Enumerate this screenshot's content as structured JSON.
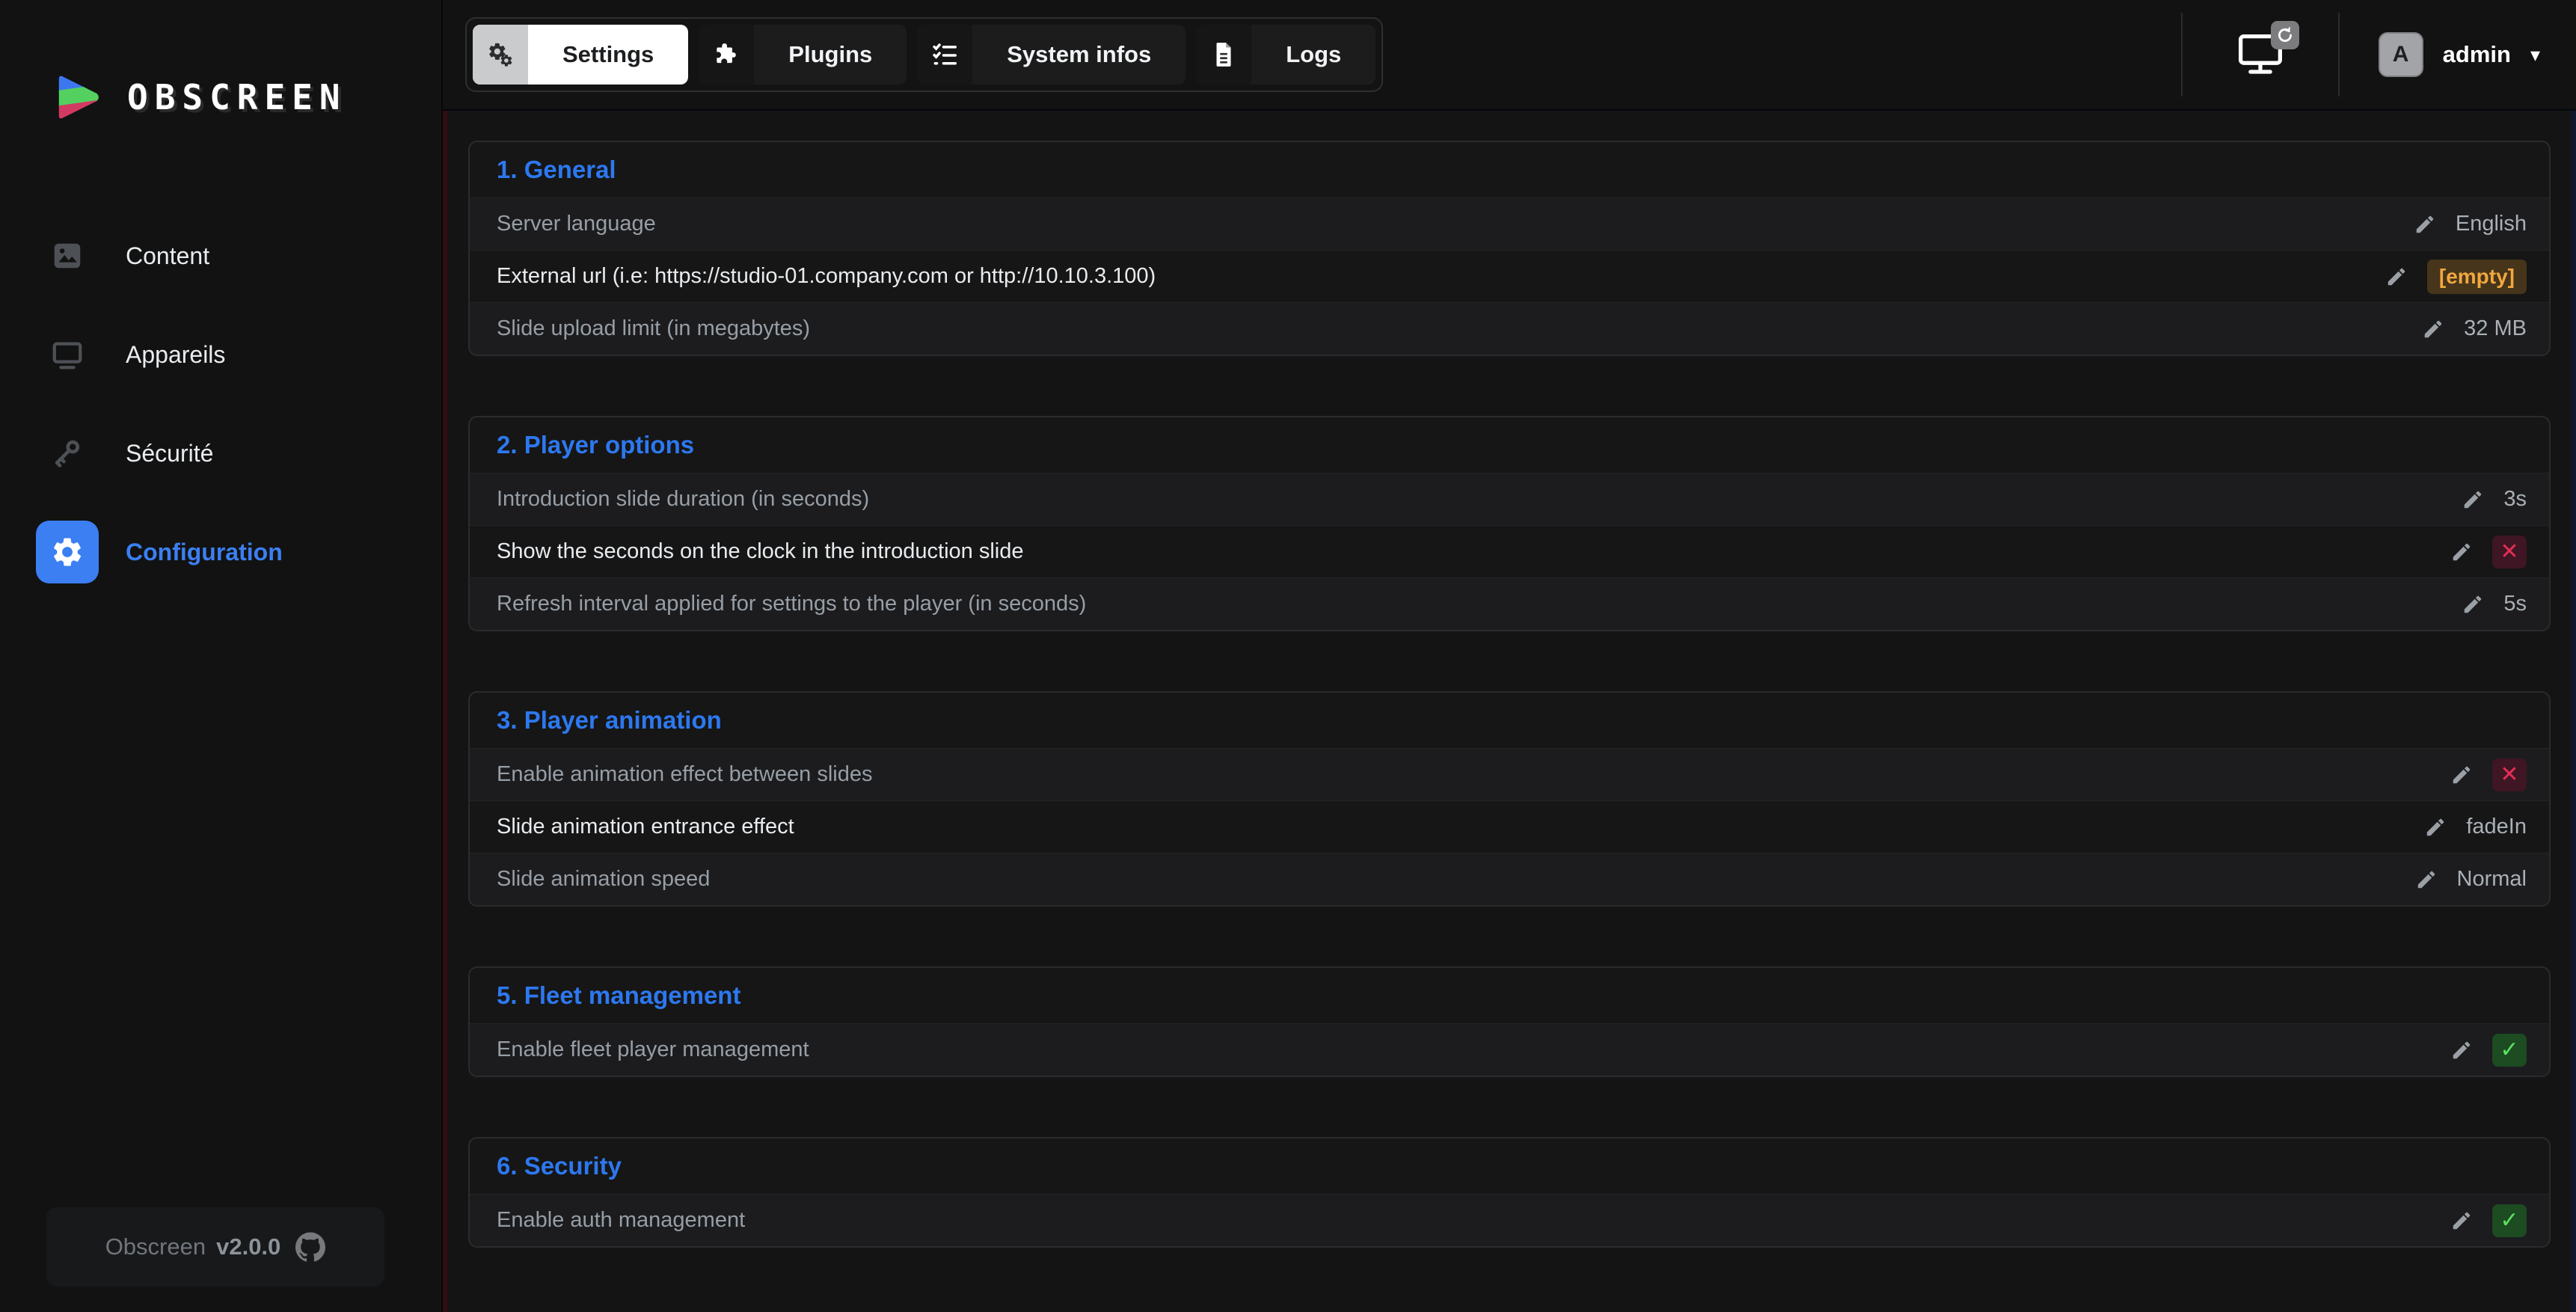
{
  "brand": {
    "name": "OBSCREEN"
  },
  "sidebar": {
    "items": [
      {
        "label": "Content"
      },
      {
        "label": "Appareils"
      },
      {
        "label": "Sécurité"
      },
      {
        "label": "Configuration",
        "active": true
      }
    ],
    "footer": {
      "app": "Obscreen",
      "version": "v2.0.0"
    }
  },
  "tabs": [
    {
      "label": "Settings",
      "active": true
    },
    {
      "label": "Plugins"
    },
    {
      "label": "System infos"
    },
    {
      "label": "Logs"
    }
  ],
  "user": {
    "name": "admin",
    "avatar_initial": "A"
  },
  "icons": {
    "cross": "✕",
    "check": "✓",
    "caret_down": "▾"
  },
  "colors": {
    "accent_blue": "#2d78f0",
    "badge_red": "#e32e56",
    "badge_green": "#5be25f",
    "badge_amber": "#f1a73f"
  },
  "sections": [
    {
      "title": "1. General",
      "rows": [
        {
          "label": "Server language",
          "value": "English",
          "type": "text"
        },
        {
          "label": "External url (i.e: https://studio-01.company.com or http://10.10.3.100)",
          "value": "[empty]",
          "type": "empty-badge"
        },
        {
          "label": "Slide upload limit (in megabytes)",
          "value": "32 MB",
          "type": "text"
        }
      ]
    },
    {
      "title": "2. Player options",
      "rows": [
        {
          "label": "Introduction slide duration (in seconds)",
          "value": "3s",
          "type": "text"
        },
        {
          "label": "Show the seconds on the clock in the introduction slide",
          "value": "off",
          "type": "cross-badge"
        },
        {
          "label": "Refresh interval applied for settings to the player (in seconds)",
          "value": "5s",
          "type": "text"
        }
      ]
    },
    {
      "title": "3. Player animation",
      "rows": [
        {
          "label": "Enable animation effect between slides",
          "value": "off",
          "type": "cross-badge"
        },
        {
          "label": "Slide animation entrance effect",
          "value": "fadeIn",
          "type": "text"
        },
        {
          "label": "Slide animation speed",
          "value": "Normal",
          "type": "text"
        }
      ]
    },
    {
      "title": "5. Fleet management",
      "rows": [
        {
          "label": "Enable fleet player management",
          "value": "on",
          "type": "check-badge"
        }
      ]
    },
    {
      "title": "6. Security",
      "rows": [
        {
          "label": "Enable auth management",
          "value": "on",
          "type": "check-badge"
        }
      ]
    }
  ]
}
